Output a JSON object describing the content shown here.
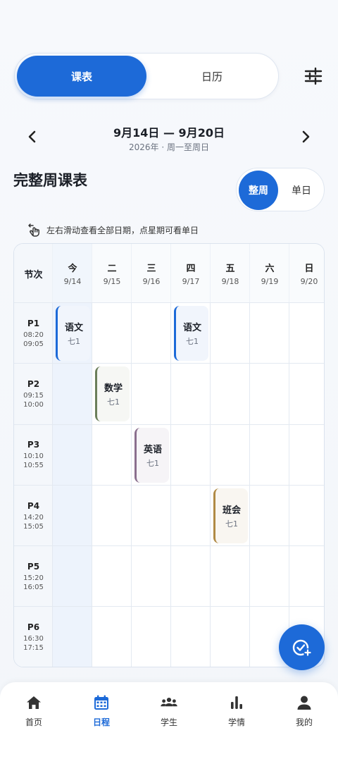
{
  "tabs": {
    "schedule": "课表",
    "calendar": "日历"
  },
  "week": {
    "range": "9月14日 — 9月20日",
    "subtitle": "2026年 · 周一至周日"
  },
  "section": {
    "title": "完整周课表",
    "view_week": "整周",
    "view_day": "单日"
  },
  "hint": "左右滑动查看全部日期，点星期可看单日",
  "grid": {
    "corner": "节次",
    "days": [
      {
        "day": "今",
        "date": "9/14"
      },
      {
        "day": "二",
        "date": "9/15"
      },
      {
        "day": "三",
        "date": "9/16"
      },
      {
        "day": "四",
        "date": "9/17"
      },
      {
        "day": "五",
        "date": "9/18"
      },
      {
        "day": "六",
        "date": "9/19"
      },
      {
        "day": "日",
        "date": "9/20"
      }
    ],
    "periods": [
      {
        "name": "P1",
        "start": "08:20",
        "end": "09:05"
      },
      {
        "name": "P2",
        "start": "09:15",
        "end": "10:00"
      },
      {
        "name": "P3",
        "start": "10:10",
        "end": "10:55"
      },
      {
        "name": "P4",
        "start": "14:20",
        "end": "15:05"
      },
      {
        "name": "P5",
        "start": "15:20",
        "end": "16:05"
      },
      {
        "name": "P6",
        "start": "16:30",
        "end": "17:15"
      }
    ],
    "courses": [
      {
        "name": "语文",
        "class": "七1",
        "day": 0,
        "period": 0,
        "color": "#1d6ad8",
        "bg": "#f1f5fc"
      },
      {
        "name": "语文",
        "class": "七1",
        "day": 3,
        "period": 0,
        "color": "#1d6ad8",
        "bg": "#f1f5fc"
      },
      {
        "name": "数学",
        "class": "七1",
        "day": 1,
        "period": 1,
        "color": "#6b7f5a",
        "bg": "#f6f7f4"
      },
      {
        "name": "英语",
        "class": "七1",
        "day": 2,
        "period": 2,
        "color": "#8a6f8e",
        "bg": "#f6f4f7"
      },
      {
        "name": "班会",
        "class": "七1",
        "day": 4,
        "period": 3,
        "color": "#b08a45",
        "bg": "#f9f6f1"
      }
    ]
  },
  "nav": [
    {
      "label": "首页",
      "icon": "home-icon"
    },
    {
      "label": "日程",
      "icon": "calendar-icon",
      "active": true
    },
    {
      "label": "学生",
      "icon": "people-icon"
    },
    {
      "label": "学情",
      "icon": "bar-chart-icon"
    },
    {
      "label": "我的",
      "icon": "person-icon"
    }
  ],
  "colors": {
    "accent": "#1d6ad8",
    "today_col": "#edf3fc",
    "header_bg": "#f4f7fb"
  }
}
